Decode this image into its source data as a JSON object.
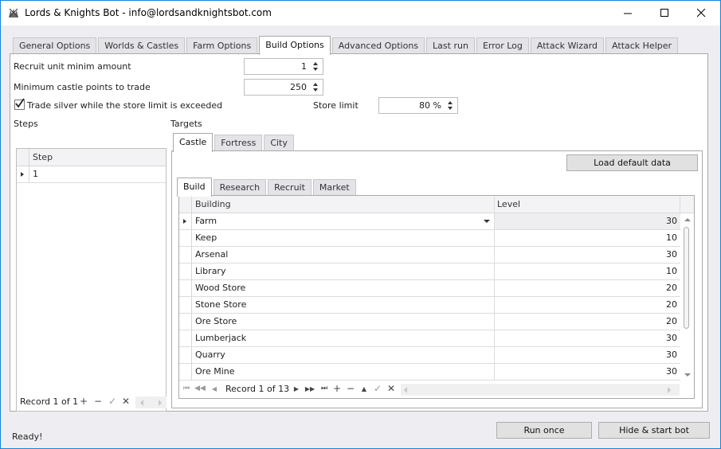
{
  "window": {
    "title": "Lords & Knights Bot - info@lordsandknightsbot.com",
    "controls": {
      "minimize": "minimize-icon",
      "maximize": "maximize-icon",
      "close": "close-icon"
    }
  },
  "main_tabs": [
    {
      "label": "General Options",
      "active": false
    },
    {
      "label": "Worlds & Castles",
      "active": false
    },
    {
      "label": "Farm Options",
      "active": false
    },
    {
      "label": "Build Options",
      "active": true
    },
    {
      "label": "Advanced Options",
      "active": false
    },
    {
      "label": "Last run",
      "active": false
    },
    {
      "label": "Error Log",
      "active": false
    },
    {
      "label": "Attack Wizard",
      "active": false
    },
    {
      "label": "Attack Helper",
      "active": false
    }
  ],
  "build_options": {
    "recruit_min_label": "Recruit unit minim amount",
    "recruit_min_value": "1",
    "min_castle_points_label": "Minimum castle points to trade",
    "min_castle_points_value": "250",
    "trade_silver_label": "Trade silver while the store limit is exceeded",
    "trade_silver_checked": true,
    "store_limit_label": "Store limit",
    "store_limit_value": "80 %",
    "steps_label": "Steps",
    "targets_label": "Targets"
  },
  "steps_grid": {
    "header": "Step",
    "rows": [
      "1"
    ],
    "record_text": "Record 1 of 1"
  },
  "target_tabs": [
    {
      "label": "Castle",
      "active": true
    },
    {
      "label": "Fortress",
      "active": false
    },
    {
      "label": "City",
      "active": false
    }
  ],
  "load_default_label": "Load default data",
  "build_tabs": [
    {
      "label": "Build",
      "active": true
    },
    {
      "label": "Research",
      "active": false
    },
    {
      "label": "Recruit",
      "active": false
    },
    {
      "label": "Market",
      "active": false
    }
  ],
  "build_grid": {
    "headers": [
      "Building",
      "Level"
    ],
    "rows": [
      {
        "building": "Farm",
        "level": "30"
      },
      {
        "building": "Keep",
        "level": "10"
      },
      {
        "building": "Arsenal",
        "level": "30"
      },
      {
        "building": "Library",
        "level": "10"
      },
      {
        "building": "Wood Store",
        "level": "20"
      },
      {
        "building": "Stone Store",
        "level": "20"
      },
      {
        "building": "Ore Store",
        "level": "20"
      },
      {
        "building": "Lumberjack",
        "level": "30"
      },
      {
        "building": "Quarry",
        "level": "30"
      },
      {
        "building": "Ore Mine",
        "level": "30"
      }
    ],
    "record_text": "Record 1 of 13"
  },
  "footer": {
    "status": "Ready!",
    "run_once_label": "Run once",
    "hide_start_label": "Hide & start bot"
  }
}
